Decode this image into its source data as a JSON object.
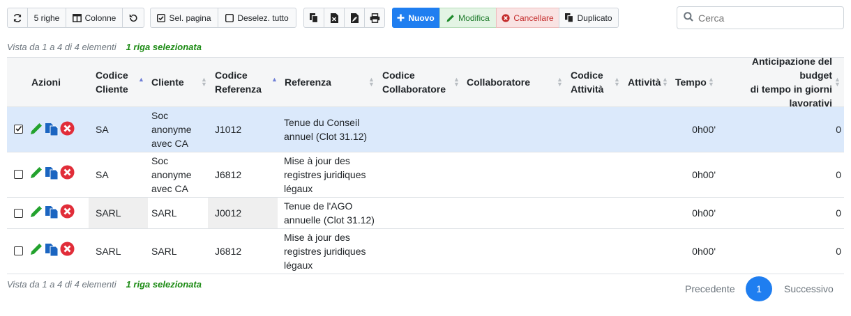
{
  "toolbar": {
    "refresh_icon": "refresh-icon",
    "rows_label": "5 righe",
    "columns_label": "Colonne",
    "reset_icon": "undo-icon",
    "select_page_label": "Sel. pagina",
    "deselect_all_label": "Deselez. tutto",
    "copy_icon": "copy-icon",
    "excel_icon": "excel-file-icon",
    "pdf_icon": "pdf-file-icon",
    "print_icon": "printer-icon",
    "new_label": "Nuovo",
    "edit_label": "Modifica",
    "delete_label": "Cancellare",
    "duplicate_label": "Duplicato"
  },
  "search": {
    "placeholder": "Cerca",
    "icon": "search-icon"
  },
  "info": {
    "showing": "Vista da 1 a 4 di 4 elementi",
    "selected": "1 riga selezionata"
  },
  "columns": {
    "actions": "Azioni",
    "client_code_1": "Codice",
    "client_code_2": "Cliente",
    "client": "Cliente",
    "ref_code_1": "Codice",
    "ref_code_2": "Referenza",
    "reference": "Referenza",
    "collab_code_1": "Codice",
    "collab_code_2": "Collaboratore",
    "collaborator": "Collaboratore",
    "activity_code_1": "Codice",
    "activity_code_2": "Attività",
    "activity": "Attività",
    "time": "Tempo",
    "budget_1": "Anticipazione del budget",
    "budget_2": "di tempo in giorni",
    "budget_3": "lavorativi"
  },
  "rows": [
    {
      "selected": true,
      "client_code": "SA",
      "client": [
        "Soc",
        "anonyme",
        "avec CA"
      ],
      "ref_code": "J1012",
      "reference": [
        "Tenue du Conseil",
        "annuel (Clot 31.12)"
      ],
      "time": "0h00'",
      "budget": "0"
    },
    {
      "selected": false,
      "client_code": "SA",
      "client": [
        "Soc",
        "anonyme",
        "avec CA"
      ],
      "ref_code": "J6812",
      "reference": [
        "Mise à jour des",
        "registres juridiques",
        "légaux"
      ],
      "time": "0h00'",
      "budget": "0"
    },
    {
      "selected": false,
      "client_code": "SARL",
      "client": [
        "SARL"
      ],
      "ref_code": "J0012",
      "reference": [
        "Tenue de l'AGO",
        "annuelle (Clot 31.12)"
      ],
      "time": "0h00'",
      "budget": "0"
    },
    {
      "selected": false,
      "client_code": "SARL",
      "client": [
        "SARL"
      ],
      "ref_code": "J6812",
      "reference": [
        "Mise à jour des",
        "registres juridiques",
        "légaux"
      ],
      "time": "0h00'",
      "budget": "0"
    }
  ],
  "row_actions": {
    "edit_icon": "pencil-icon",
    "copy_icon": "copy-icon",
    "delete_icon": "delete-circle-icon"
  },
  "pagination": {
    "previous": "Precedente",
    "current": "1",
    "next": "Successivo"
  },
  "colors": {
    "primary": "#1f7ef0",
    "success": "#1a8a12",
    "danger": "#e12d39",
    "selected_row": "#dbe9fb"
  }
}
